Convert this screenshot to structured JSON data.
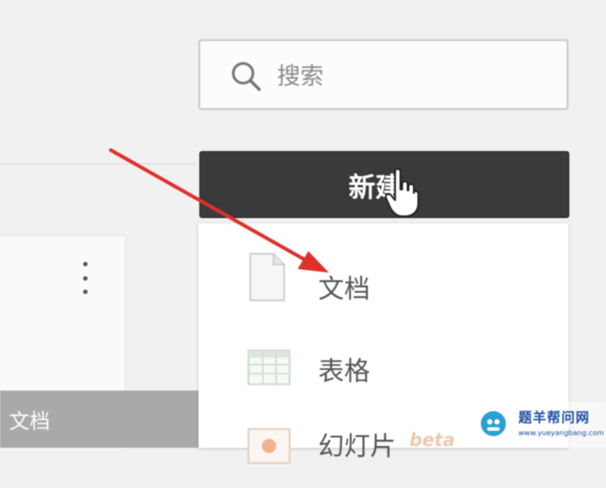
{
  "search": {
    "placeholder": "搜索"
  },
  "new_button": {
    "label": "新建"
  },
  "new_menu": {
    "items": [
      {
        "label": "文档",
        "icon": "document-icon"
      },
      {
        "label": "表格",
        "icon": "spreadsheet-icon"
      },
      {
        "label": "幻灯片",
        "icon": "slides-icon"
      }
    ],
    "beta_tag": "beta"
  },
  "file_card": {
    "type_label": "文档",
    "menu_icon": "more-vertical-icon"
  },
  "watermark": {
    "title": "题羊帮问网",
    "url": "www.yueyangbang.com"
  },
  "colors": {
    "button_bg": "#3a3a3a",
    "accent_teal": "#1f8a80",
    "arrow_red": "#e0302a",
    "watermark_blue": "#1e4fa0"
  }
}
